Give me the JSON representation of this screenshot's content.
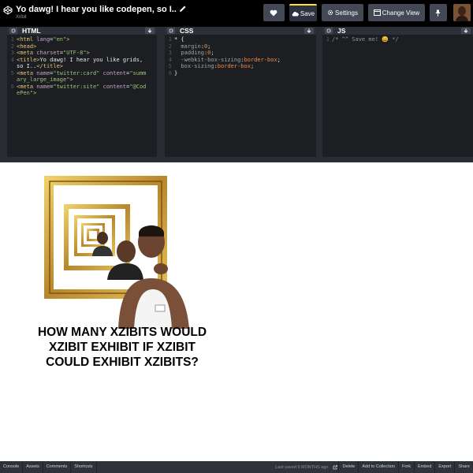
{
  "header": {
    "title": "Yo dawg! I hear you like codepen, so I..",
    "author": "Xribit",
    "buttons": {
      "save": "Save",
      "settings": "Settings",
      "change_view": "Change View"
    }
  },
  "editors": {
    "html": {
      "name": "HTML",
      "lines": [
        {
          "n": "1",
          "segs": [
            [
              "tag",
              "<html "
            ],
            [
              "attr",
              "lang"
            ],
            [
              "plain",
              "="
            ],
            [
              "str",
              "\"en\""
            ],
            [
              "tag",
              ">"
            ]
          ]
        },
        {
          "n": "2",
          "segs": [
            [
              "tag",
              "<head>"
            ]
          ]
        },
        {
          "n": "3",
          "segs": [
            [
              "tag",
              "<meta "
            ],
            [
              "attr",
              "charset"
            ],
            [
              "plain",
              "="
            ],
            [
              "str",
              "\"UTF-8\""
            ],
            [
              "tag",
              ">"
            ]
          ]
        },
        {
          "n": "4",
          "segs": [
            [
              "tag",
              "<title>"
            ],
            [
              "plain",
              "Yo dawg! I hear you like grids,"
            ]
          ]
        },
        {
          "n": "",
          "segs": [
            [
              "plain",
              "so I.."
            ],
            [
              "tag",
              "</title>"
            ]
          ]
        },
        {
          "n": "5",
          "segs": [
            [
              "tag",
              "<meta "
            ],
            [
              "attr",
              "name"
            ],
            [
              "plain",
              "="
            ],
            [
              "str",
              "\"twitter:card\""
            ],
            [
              "attr",
              " content"
            ],
            [
              "plain",
              "="
            ],
            [
              "str",
              "\"summ"
            ]
          ]
        },
        {
          "n": "",
          "segs": [
            [
              "str",
              "ary_large_image\""
            ],
            [
              "tag",
              ">"
            ]
          ]
        },
        {
          "n": "6",
          "segs": [
            [
              "tag",
              "<meta "
            ],
            [
              "attr",
              "name"
            ],
            [
              "plain",
              "="
            ],
            [
              "str",
              "\"twitter:site\""
            ],
            [
              "attr",
              " content"
            ],
            [
              "plain",
              "="
            ],
            [
              "str",
              "\"@Cod"
            ]
          ]
        },
        {
          "n": "",
          "segs": [
            [
              "str",
              "ePen\""
            ],
            [
              "tag",
              ">"
            ]
          ]
        }
      ]
    },
    "css": {
      "name": "CSS",
      "lines": [
        {
          "n": "1",
          "segs": [
            [
              "plain",
              "* {"
            ]
          ]
        },
        {
          "n": "2",
          "segs": [
            [
              "prop",
              "  margin"
            ],
            [
              "plain",
              ":"
            ],
            [
              "val",
              "0"
            ],
            [
              "plain",
              ";"
            ]
          ]
        },
        {
          "n": "3",
          "segs": [
            [
              "prop",
              "  padding"
            ],
            [
              "plain",
              ":"
            ],
            [
              "val",
              "0"
            ],
            [
              "plain",
              ";"
            ]
          ]
        },
        {
          "n": "4",
          "segs": [
            [
              "prop",
              "  -webkit-box-sizing"
            ],
            [
              "plain",
              ":"
            ],
            [
              "val",
              "border-box"
            ],
            [
              "plain",
              ";"
            ]
          ]
        },
        {
          "n": "5",
          "segs": [
            [
              "prop",
              "  box-sizing"
            ],
            [
              "plain",
              ":"
            ],
            [
              "val",
              "border-box"
            ],
            [
              "plain",
              ";"
            ]
          ]
        },
        {
          "n": "6",
          "segs": [
            [
              "plain",
              "}"
            ]
          ]
        }
      ]
    },
    "js": {
      "name": "JS",
      "lines": [
        {
          "n": "1",
          "segs": [
            [
              "cmt",
              "/* ^^ Save me! 😀 */"
            ]
          ]
        }
      ]
    }
  },
  "preview": {
    "caption_lines": [
      "HOW MANY XZIBITS WOULD",
      "XZIBIT EXHIBIT  IF XZIBIT",
      "COULD EXHIBIT XZIBITS?"
    ]
  },
  "footer": {
    "buttons": [
      "Console",
      "Assets",
      "Comments",
      "Shortcuts"
    ],
    "last_saved": "Last saved 9 MONTHS ago",
    "right_buttons": [
      "Delete",
      "Add to Collection",
      "Fork",
      "Embed",
      "Export",
      "Share"
    ]
  },
  "colors": {
    "save_accent": "#ffdd40",
    "header_bg": "#000000",
    "editor_bg": "#1d1e22"
  }
}
